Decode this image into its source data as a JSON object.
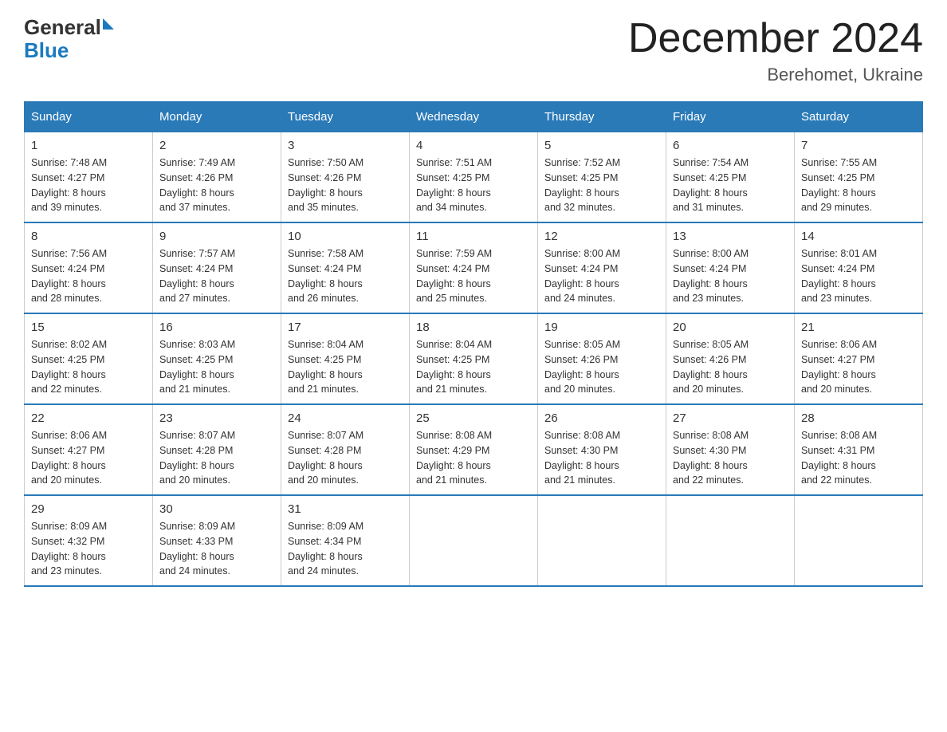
{
  "logo": {
    "text_general": "General",
    "text_blue": "Blue",
    "triangle": "▶"
  },
  "header": {
    "month_year": "December 2024",
    "location": "Berehomet, Ukraine"
  },
  "days_of_week": [
    "Sunday",
    "Monday",
    "Tuesday",
    "Wednesday",
    "Thursday",
    "Friday",
    "Saturday"
  ],
  "weeks": [
    [
      {
        "day": "1",
        "sunrise": "7:48 AM",
        "sunset": "4:27 PM",
        "daylight": "8 hours and 39 minutes."
      },
      {
        "day": "2",
        "sunrise": "7:49 AM",
        "sunset": "4:26 PM",
        "daylight": "8 hours and 37 minutes."
      },
      {
        "day": "3",
        "sunrise": "7:50 AM",
        "sunset": "4:26 PM",
        "daylight": "8 hours and 35 minutes."
      },
      {
        "day": "4",
        "sunrise": "7:51 AM",
        "sunset": "4:25 PM",
        "daylight": "8 hours and 34 minutes."
      },
      {
        "day": "5",
        "sunrise": "7:52 AM",
        "sunset": "4:25 PM",
        "daylight": "8 hours and 32 minutes."
      },
      {
        "day": "6",
        "sunrise": "7:54 AM",
        "sunset": "4:25 PM",
        "daylight": "8 hours and 31 minutes."
      },
      {
        "day": "7",
        "sunrise": "7:55 AM",
        "sunset": "4:25 PM",
        "daylight": "8 hours and 29 minutes."
      }
    ],
    [
      {
        "day": "8",
        "sunrise": "7:56 AM",
        "sunset": "4:24 PM",
        "daylight": "8 hours and 28 minutes."
      },
      {
        "day": "9",
        "sunrise": "7:57 AM",
        "sunset": "4:24 PM",
        "daylight": "8 hours and 27 minutes."
      },
      {
        "day": "10",
        "sunrise": "7:58 AM",
        "sunset": "4:24 PM",
        "daylight": "8 hours and 26 minutes."
      },
      {
        "day": "11",
        "sunrise": "7:59 AM",
        "sunset": "4:24 PM",
        "daylight": "8 hours and 25 minutes."
      },
      {
        "day": "12",
        "sunrise": "8:00 AM",
        "sunset": "4:24 PM",
        "daylight": "8 hours and 24 minutes."
      },
      {
        "day": "13",
        "sunrise": "8:00 AM",
        "sunset": "4:24 PM",
        "daylight": "8 hours and 23 minutes."
      },
      {
        "day": "14",
        "sunrise": "8:01 AM",
        "sunset": "4:24 PM",
        "daylight": "8 hours and 23 minutes."
      }
    ],
    [
      {
        "day": "15",
        "sunrise": "8:02 AM",
        "sunset": "4:25 PM",
        "daylight": "8 hours and 22 minutes."
      },
      {
        "day": "16",
        "sunrise": "8:03 AM",
        "sunset": "4:25 PM",
        "daylight": "8 hours and 21 minutes."
      },
      {
        "day": "17",
        "sunrise": "8:04 AM",
        "sunset": "4:25 PM",
        "daylight": "8 hours and 21 minutes."
      },
      {
        "day": "18",
        "sunrise": "8:04 AM",
        "sunset": "4:25 PM",
        "daylight": "8 hours and 21 minutes."
      },
      {
        "day": "19",
        "sunrise": "8:05 AM",
        "sunset": "4:26 PM",
        "daylight": "8 hours and 20 minutes."
      },
      {
        "day": "20",
        "sunrise": "8:05 AM",
        "sunset": "4:26 PM",
        "daylight": "8 hours and 20 minutes."
      },
      {
        "day": "21",
        "sunrise": "8:06 AM",
        "sunset": "4:27 PM",
        "daylight": "8 hours and 20 minutes."
      }
    ],
    [
      {
        "day": "22",
        "sunrise": "8:06 AM",
        "sunset": "4:27 PM",
        "daylight": "8 hours and 20 minutes."
      },
      {
        "day": "23",
        "sunrise": "8:07 AM",
        "sunset": "4:28 PM",
        "daylight": "8 hours and 20 minutes."
      },
      {
        "day": "24",
        "sunrise": "8:07 AM",
        "sunset": "4:28 PM",
        "daylight": "8 hours and 20 minutes."
      },
      {
        "day": "25",
        "sunrise": "8:08 AM",
        "sunset": "4:29 PM",
        "daylight": "8 hours and 21 minutes."
      },
      {
        "day": "26",
        "sunrise": "8:08 AM",
        "sunset": "4:30 PM",
        "daylight": "8 hours and 21 minutes."
      },
      {
        "day": "27",
        "sunrise": "8:08 AM",
        "sunset": "4:30 PM",
        "daylight": "8 hours and 22 minutes."
      },
      {
        "day": "28",
        "sunrise": "8:08 AM",
        "sunset": "4:31 PM",
        "daylight": "8 hours and 22 minutes."
      }
    ],
    [
      {
        "day": "29",
        "sunrise": "8:09 AM",
        "sunset": "4:32 PM",
        "daylight": "8 hours and 23 minutes."
      },
      {
        "day": "30",
        "sunrise": "8:09 AM",
        "sunset": "4:33 PM",
        "daylight": "8 hours and 24 minutes."
      },
      {
        "day": "31",
        "sunrise": "8:09 AM",
        "sunset": "4:34 PM",
        "daylight": "8 hours and 24 minutes."
      },
      null,
      null,
      null,
      null
    ]
  ],
  "labels": {
    "sunrise": "Sunrise:",
    "sunset": "Sunset:",
    "daylight": "Daylight:"
  }
}
